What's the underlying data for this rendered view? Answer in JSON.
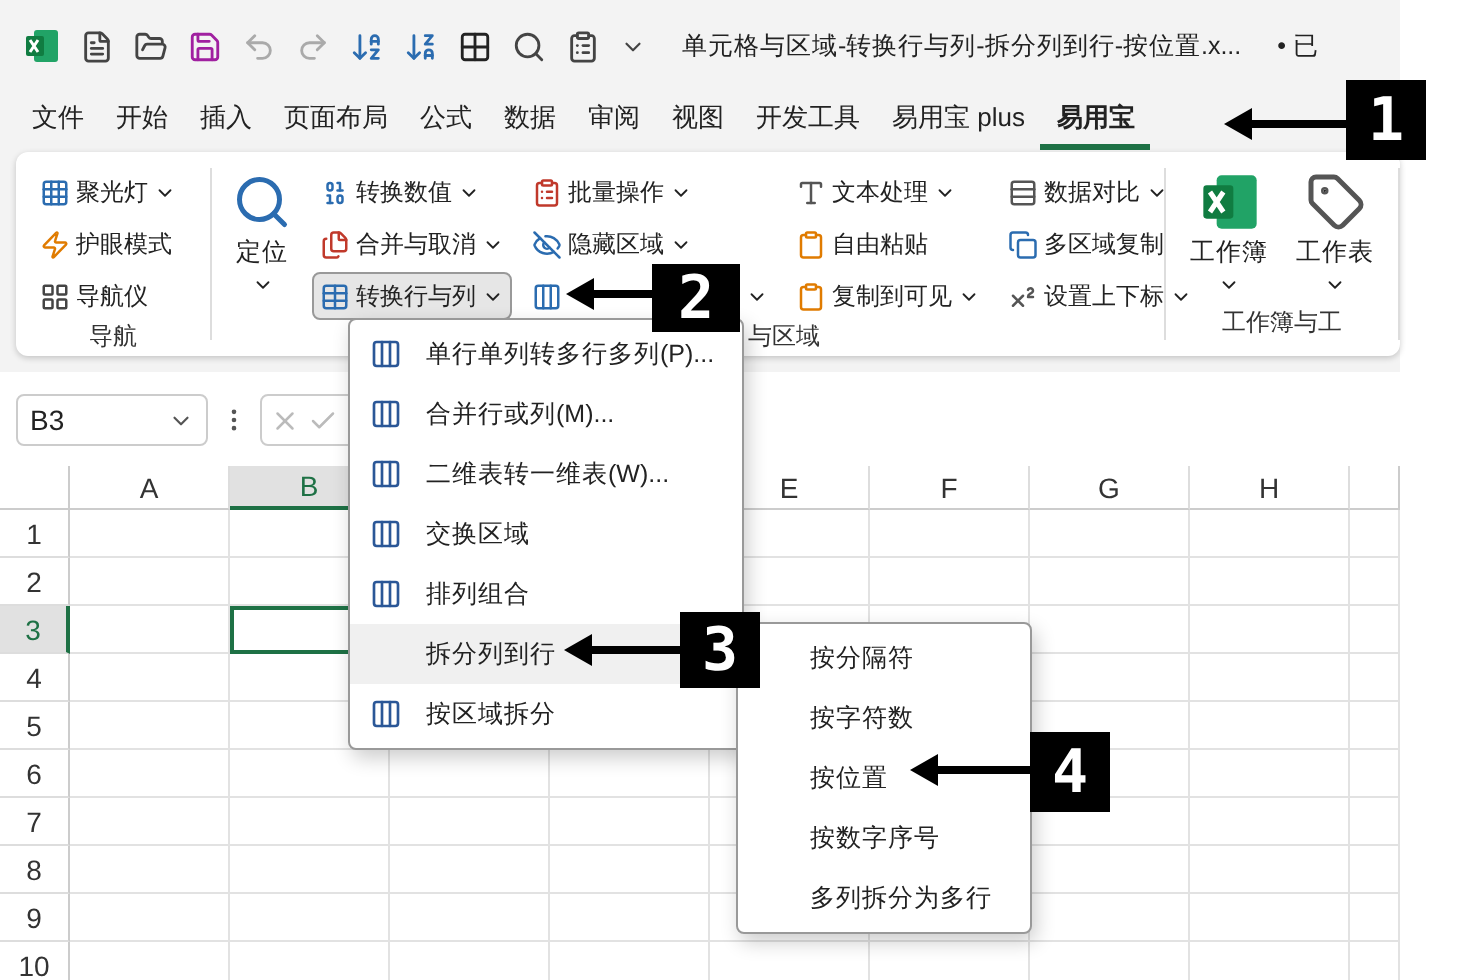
{
  "title_bar": {
    "file_title": "单元格与区域-转换行与列-拆分列到行-按位置.x...",
    "status": "• 已"
  },
  "tabs": [
    {
      "label": "文件",
      "selected": false
    },
    {
      "label": "开始",
      "selected": false
    },
    {
      "label": "插入",
      "selected": false
    },
    {
      "label": "页面布局",
      "selected": false
    },
    {
      "label": "公式",
      "selected": false
    },
    {
      "label": "数据",
      "selected": false
    },
    {
      "label": "审阅",
      "selected": false
    },
    {
      "label": "视图",
      "selected": false
    },
    {
      "label": "开发工具",
      "selected": false
    },
    {
      "label": "易用宝 plus",
      "selected": false
    },
    {
      "label": "易用宝",
      "selected": true
    }
  ],
  "ribbon": {
    "groups": [
      {
        "label": "导航",
        "controls": [
          {
            "kind": "stack",
            "items": [
              {
                "label": "聚光灯",
                "dropdown": true,
                "pressed": false
              },
              {
                "label": "护眼模式",
                "dropdown": false,
                "pressed": false
              },
              {
                "label": "导航仪",
                "dropdown": false,
                "pressed": false
              }
            ]
          }
        ]
      },
      {
        "label": "与区域",
        "controls": [
          {
            "kind": "large",
            "label": "定位",
            "dropdown": true
          },
          {
            "kind": "stack",
            "items": [
              {
                "label": "转换数值",
                "dropdown": true,
                "pressed": false
              },
              {
                "label": "合并与取消",
                "dropdown": true,
                "pressed": false
              },
              {
                "label": "转换行与列",
                "dropdown": true,
                "pressed": true
              }
            ]
          },
          {
            "kind": "stack",
            "items": [
              {
                "label": "批量操作",
                "dropdown": true,
                "pressed": false
              },
              {
                "label": "隐藏区域",
                "dropdown": true,
                "pressed": false
              },
              {
                "dropdown": true,
                "pressed": false
              }
            ]
          },
          {
            "kind": "stack",
            "items": [
              {
                "label": "文本处理",
                "dropdown": true,
                "pressed": false
              },
              {
                "label": "自由粘贴",
                "dropdown": false,
                "pressed": false
              },
              {
                "label": "复制到可见",
                "dropdown": true,
                "pressed": false
              }
            ]
          },
          {
            "kind": "stack",
            "items": [
              {
                "label": "数据对比",
                "dropdown": true,
                "pressed": false
              },
              {
                "label": "多区域复制",
                "dropdown": false,
                "pressed": false
              },
              {
                "label": "设置上下标",
                "dropdown": true,
                "pressed": false
              }
            ]
          }
        ]
      },
      {
        "label": "工作簿与工",
        "controls": [
          {
            "kind": "large",
            "label": "工作簿",
            "dropdown": true
          },
          {
            "kind": "large",
            "label": "工作表",
            "dropdown": true
          }
        ]
      }
    ]
  },
  "formula_bar": {
    "name_box": "B3"
  },
  "sheet": {
    "columns": [
      {
        "label": "A",
        "selected": false
      },
      {
        "label": "B",
        "selected": true
      },
      {},
      {},
      {
        "label": "E",
        "selected": false
      },
      {
        "label": "F",
        "selected": false
      },
      {
        "label": "G",
        "selected": false
      },
      {
        "label": "H",
        "selected": false
      }
    ],
    "rows": [
      {
        "label": "1",
        "selected": false
      },
      {
        "label": "2",
        "selected": false
      },
      {
        "label": "3",
        "selected": true
      },
      {
        "label": "4",
        "selected": false
      },
      {
        "label": "5",
        "selected": false
      },
      {
        "label": "6",
        "selected": false
      },
      {
        "label": "7",
        "selected": false
      },
      {
        "label": "8",
        "selected": false
      },
      {
        "label": "9",
        "selected": false
      },
      {
        "label": "10",
        "selected": false
      }
    ]
  },
  "menu": {
    "items": [
      {
        "label": "单行单列转多行多列(P)...",
        "icon": true,
        "selected": false
      },
      {
        "label": "合并行或列(M)...",
        "icon": true,
        "selected": false
      },
      {
        "label": "二维表转一维表(W)...",
        "icon": true,
        "selected": false
      },
      {
        "label": "交换区域",
        "icon": true,
        "selected": false
      },
      {
        "label": "排列组合",
        "icon": true,
        "selected": false
      },
      {
        "label": "拆分列到行",
        "icon": false,
        "selected": true
      },
      {
        "label": "按区域拆分",
        "icon": true,
        "selected": false
      }
    ]
  },
  "submenu": {
    "items": [
      {
        "label": "按分隔符",
        "selected": false
      },
      {
        "label": "按字符数",
        "selected": false
      },
      {
        "label": "按位置",
        "selected": false
      },
      {
        "label": "按数字序号",
        "selected": false
      },
      {
        "label": "多列拆分为多行",
        "selected": false
      }
    ]
  },
  "callouts": [
    {
      "number": "1"
    },
    {
      "number": "2"
    },
    {
      "number": "3"
    },
    {
      "number": "4"
    }
  ]
}
